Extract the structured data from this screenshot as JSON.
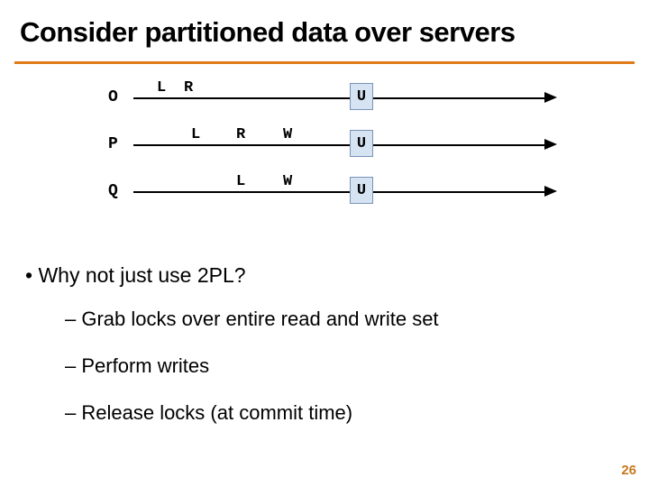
{
  "title": "Consider partitioned data over servers",
  "diagram": {
    "rows": [
      {
        "label": "O",
        "events": {
          "L": "L",
          "R": "R"
        },
        "U": "U"
      },
      {
        "label": "P",
        "events": {
          "L": "L",
          "R": "R",
          "W": "W"
        },
        "U": "U"
      },
      {
        "label": "Q",
        "events": {
          "L": "L",
          "W": "W"
        },
        "U": "U"
      }
    ]
  },
  "body": {
    "q": "Why not just use 2PL?",
    "sub1": "Grab locks over entire read and write set",
    "sub2": "Perform writes",
    "sub3": "Release locks (at commit time)"
  },
  "pagenum": "26"
}
